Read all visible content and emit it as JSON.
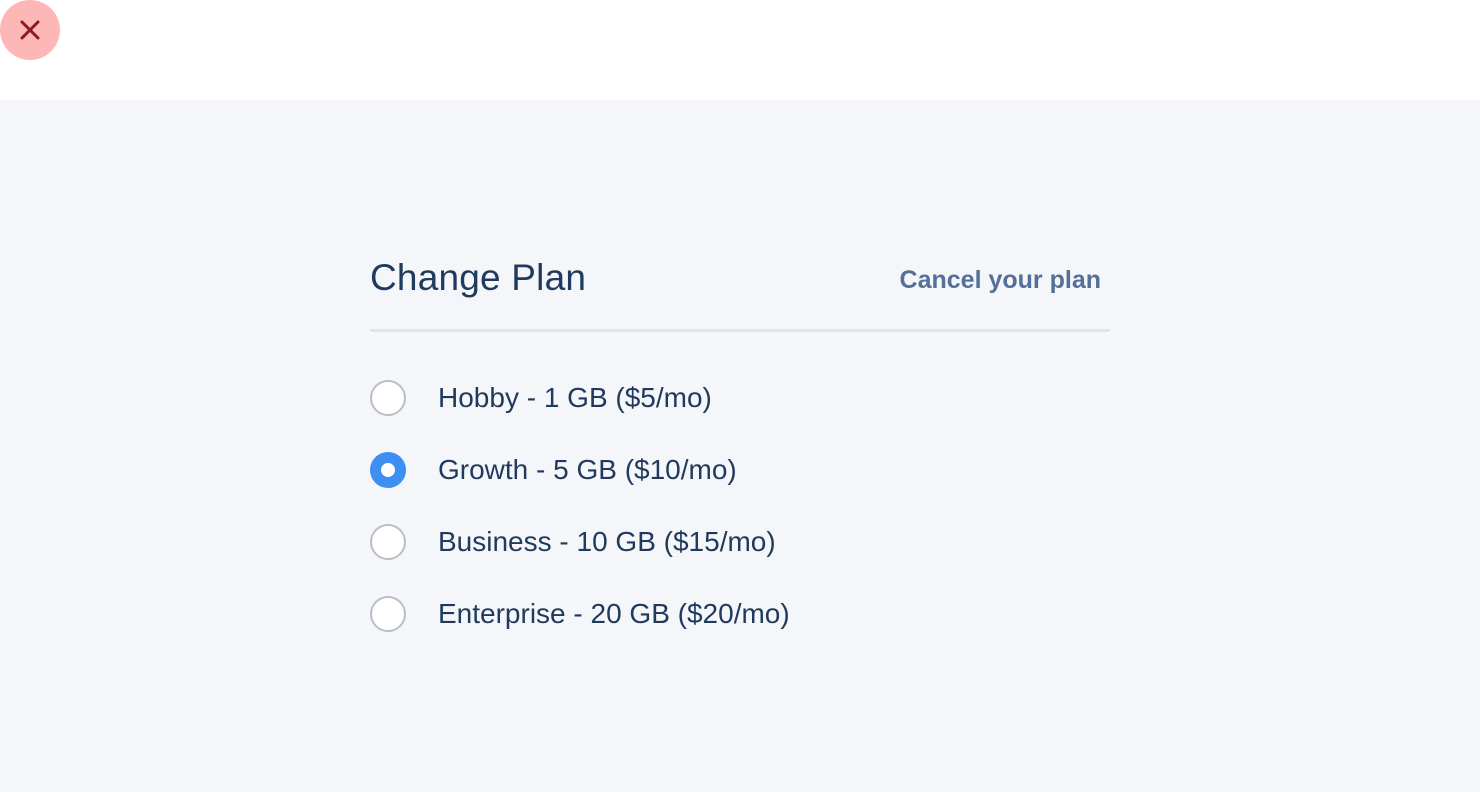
{
  "modal": {
    "close_icon": "close-icon",
    "title": "Change Plan",
    "cancel_link": "Cancel your plan"
  },
  "plans": [
    {
      "label": "Hobby - 1 GB ($5/mo)",
      "selected": false
    },
    {
      "label": "Growth - 5 GB ($10/mo)",
      "selected": true
    },
    {
      "label": "Business - 10 GB ($15/mo)",
      "selected": false
    },
    {
      "label": "Enterprise - 20 GB ($20/mo)",
      "selected": false
    }
  ],
  "colors": {
    "accent": "#3d8ff2",
    "close_bg": "#fdb7b7",
    "close_icon": "#8c1c1c",
    "text": "#1f3a5c",
    "link": "#52709a",
    "content_bg": "#f5f6f9"
  }
}
